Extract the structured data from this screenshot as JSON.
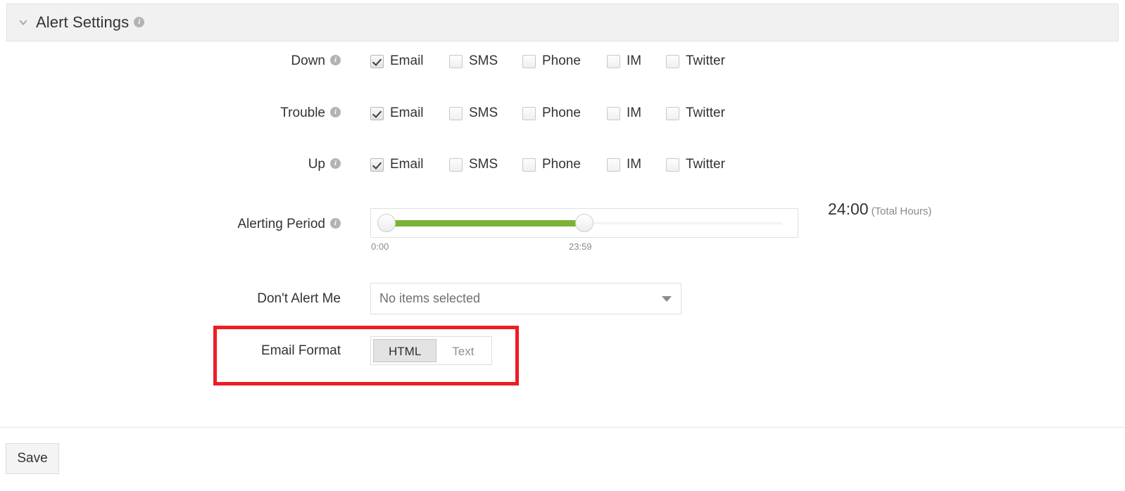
{
  "panel": {
    "title": "Alert Settings",
    "collapse_icon": "chevron-down-icon",
    "info_icon": "info-icon"
  },
  "alert_rows": [
    {
      "label": "Down",
      "options": [
        {
          "label": "Email",
          "checked": true
        },
        {
          "label": "SMS",
          "checked": false
        },
        {
          "label": "Phone",
          "checked": false
        },
        {
          "label": "IM",
          "checked": false
        },
        {
          "label": "Twitter",
          "checked": false
        }
      ]
    },
    {
      "label": "Trouble",
      "options": [
        {
          "label": "Email",
          "checked": true
        },
        {
          "label": "SMS",
          "checked": false
        },
        {
          "label": "Phone",
          "checked": false
        },
        {
          "label": "IM",
          "checked": false
        },
        {
          "label": "Twitter",
          "checked": false
        }
      ]
    },
    {
      "label": "Up",
      "options": [
        {
          "label": "Email",
          "checked": true
        },
        {
          "label": "SMS",
          "checked": false
        },
        {
          "label": "Phone",
          "checked": false
        },
        {
          "label": "IM",
          "checked": false
        },
        {
          "label": "Twitter",
          "checked": false
        }
      ]
    }
  ],
  "alerting_period": {
    "label": "Alerting Period",
    "start_tick": "0:00",
    "end_tick": "23:59",
    "total_value": "24:00",
    "total_unit": "(Total Hours)",
    "range_color": "#7eb235"
  },
  "dont_alert_me": {
    "label": "Don't Alert Me",
    "value": "No items selected",
    "caret_icon": "caret-down-icon"
  },
  "email_format": {
    "label": "Email Format",
    "options": [
      "HTML",
      "Text"
    ],
    "selected": "HTML",
    "highlight_color": "#ee1c25"
  },
  "footer": {
    "save_label": "Save"
  }
}
